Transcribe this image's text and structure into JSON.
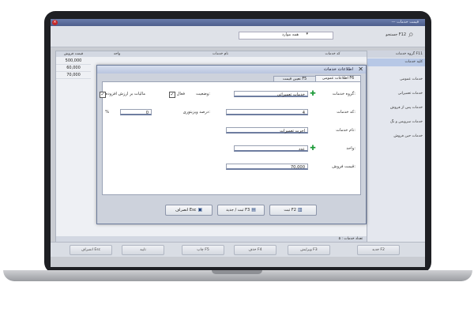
{
  "app": {
    "title": "— قیمت خدمات",
    "close_glyph": "●"
  },
  "toolbar": {
    "search_label": "جستجو F12",
    "all_items": "همه موارد",
    "dropdown": "▾"
  },
  "grid": {
    "headers": [
      "قیمت فروش",
      "واحد",
      "نام خدمات",
      "کد خدمات"
    ],
    "rows": [
      {
        "price": "500,000",
        "unit": "",
        "name": "",
        "code": ""
      },
      {
        "price": "60,000",
        "unit": "",
        "name": "",
        "code": ""
      },
      {
        "price": "70,000",
        "unit": "",
        "name": "",
        "code": ""
      }
    ],
    "footer_count": "تعداد خدمات : ۵"
  },
  "right_panel": {
    "header": "گروه خدمات F11",
    "items": [
      "کلیه خدمات",
      "خدمات عمومی",
      "خدمات تعمیراتی",
      "خدمات پس از فروش",
      "خدمات سرویس و نگ",
      "خدمات حین فروش"
    ]
  },
  "bottom_bar": {
    "new": "جدید F2",
    "edit": "ویرایش F3",
    "delete": "حذف F4",
    "print": "چاپ F5",
    "confirm": "تایید",
    "cancel": "انصراف Esc"
  },
  "dialog": {
    "title": "اطلاعات خدمات",
    "close": "✕",
    "tab_general": "اطلاعات عمومی F6",
    "tab_price": "تعیین قیمت F5",
    "fields": {
      "group_label": "گروه خدمات:",
      "group_value": "خدمات تعمیراتی",
      "status_label": "وضعیت:",
      "active_label": "فعال",
      "code_label": "کد خدمات:",
      "code_value": "4",
      "discount_label": "درصد ویزیتوری:",
      "discount_value": "0",
      "discount_unit": "%",
      "vat_label": "مالیات بر ارزش افزوده",
      "name_label": "نام خدمات:",
      "name_value": "اجرت تعمیرات",
      "unit_label": "واحد:",
      "unit_value": "عدد",
      "price_label": "قیمت فروش:",
      "price_value": "70,000"
    },
    "buttons": {
      "save": "ثبت F2",
      "save_new": "ثبت / جدید F3",
      "cancel": "انصراف Esc"
    }
  }
}
